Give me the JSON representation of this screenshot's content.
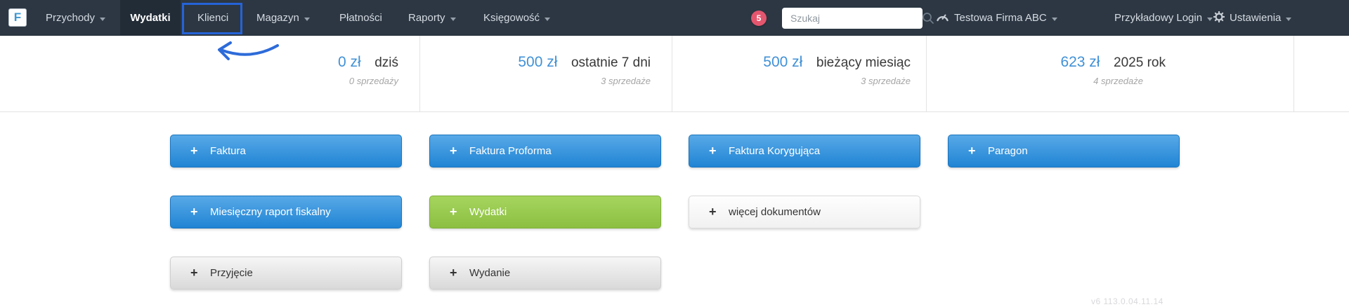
{
  "nav": {
    "logo_letter": "F",
    "items": [
      {
        "label": "Przychody",
        "caret": true
      },
      {
        "label": "Wydatki",
        "caret": false,
        "active": true
      },
      {
        "label": "Klienci",
        "caret": false,
        "annotated": true
      },
      {
        "label": "Magazyn",
        "caret": true
      },
      {
        "label": "Płatności",
        "caret": false
      },
      {
        "label": "Raporty",
        "caret": true
      },
      {
        "label": "Księgowość",
        "caret": true
      }
    ],
    "notification_count": "5",
    "search_placeholder": "Szukaj",
    "company": "Testowa Firma ABC",
    "user": "Przykładowy Login",
    "settings_label": "Ustawienia"
  },
  "stats": [
    {
      "value": "0 zł",
      "label": "dziś",
      "sub": "0 sprzedaży"
    },
    {
      "value": "500 zł",
      "label": "ostatnie 7 dni",
      "sub": "3 sprzedaże"
    },
    {
      "value": "500 zł",
      "label": "bieżący miesiąc",
      "sub": "3 sprzedaże"
    },
    {
      "value": "623 zł",
      "label": "2025 rok",
      "sub": "4 sprzedaże"
    }
  ],
  "actions": {
    "plus_glyph": "+",
    "rows": [
      [
        {
          "label": "Faktura",
          "color": "blue"
        },
        {
          "label": "Faktura Proforma",
          "color": "blue"
        },
        {
          "label": "Faktura Korygująca",
          "color": "blue"
        },
        {
          "label": "Paragon",
          "color": "blue"
        }
      ],
      [
        {
          "label": "Miesięczny raport fiskalny",
          "color": "blue"
        },
        {
          "label": "Wydatki",
          "color": "green"
        },
        {
          "label": "więcej dokumentów",
          "color": "white"
        }
      ],
      [
        {
          "label": "Przyjęcie",
          "color": "gray"
        },
        {
          "label": "Wydanie",
          "color": "gray"
        }
      ]
    ]
  },
  "annotations": {
    "highlighted_nav_item": "Klienci",
    "highlight_color": "#2563d8"
  },
  "watermark": "v6 113.0.04.11.14",
  "colors": {
    "navbar_bg": "#2c3743",
    "accent_blue": "#2084d4",
    "accent_green": "#8cbf42",
    "badge_red": "#e4566e",
    "stat_value_blue": "#4191d6"
  }
}
